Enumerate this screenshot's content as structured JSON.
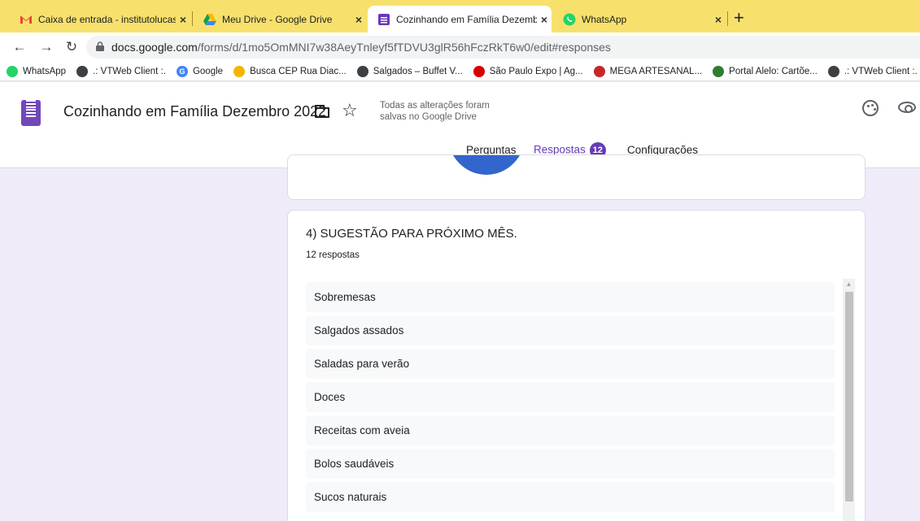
{
  "browser": {
    "tabs": [
      {
        "title": "Caixa de entrada - institutolucas",
        "icon": "gmail-icon"
      },
      {
        "title": "Meu Drive - Google Drive",
        "icon": "drive-icon"
      },
      {
        "title": "Cozinhando em Família Dezembr",
        "icon": "forms-icon",
        "active": true
      },
      {
        "title": "WhatsApp",
        "icon": "whatsapp-icon"
      }
    ],
    "new_tab_label": "+",
    "close_glyph": "×",
    "url_domain": "docs.google.com",
    "url_path": "/forms/d/1mo5OmMNI7w38AeyTnleyf5fTDVU3glR56hFczRkT6w0/edit#responses",
    "bookmarks": [
      {
        "label": "WhatsApp",
        "icon": "whatsapp-icon",
        "color": "#25d366",
        "glyph": ""
      },
      {
        "label": ".: VTWeb Client :.",
        "icon": "globe-icon",
        "color": "#3c4043",
        "glyph": ""
      },
      {
        "label": "Google",
        "icon": "google-icon",
        "color": "#4285f4",
        "glyph": "G"
      },
      {
        "label": "Busca CEP Rua Diac...",
        "icon": "cep-icon",
        "color": "#f4b400",
        "glyph": ""
      },
      {
        "label": "Salgados – Buffet V...",
        "icon": "globe-icon",
        "color": "#3c4043",
        "glyph": ""
      },
      {
        "label": "São Paulo Expo | Ag...",
        "icon": "expo-icon",
        "color": "#d50000",
        "glyph": ""
      },
      {
        "label": "MEGA ARTESANAL...",
        "icon": "mega-icon",
        "color": "#c62828",
        "glyph": ""
      },
      {
        "label": "Portal Alelo: Cartõe...",
        "icon": "alelo-icon",
        "color": "#2e7d32",
        "glyph": ""
      },
      {
        "label": ".: VTWeb Client :.",
        "icon": "globe-icon",
        "color": "#3c4043",
        "glyph": ""
      }
    ]
  },
  "form": {
    "title": "Cozinhando em Família Dezembro 2022",
    "save_status": "Todas as alterações foram salvas no Google Drive",
    "tabs": {
      "questions": "Perguntas",
      "responses": "Respostas",
      "responses_count": "12",
      "settings": "Configurações"
    }
  },
  "question": {
    "title": "4) SUGESTÃO PARA PRÓXIMO MÊS.",
    "count": "12 respostas",
    "answers": [
      "Sobremesas",
      "Salgados assados",
      "Saladas para verão",
      "Doces",
      "Receitas com aveia",
      "Bolos saudáveis",
      "Sucos naturais"
    ]
  },
  "colors": {
    "tabstrip": "#f7e16c",
    "accent": "#673ab7",
    "page_bg": "#f0ebf8",
    "chart_blue": "#3366cc"
  }
}
